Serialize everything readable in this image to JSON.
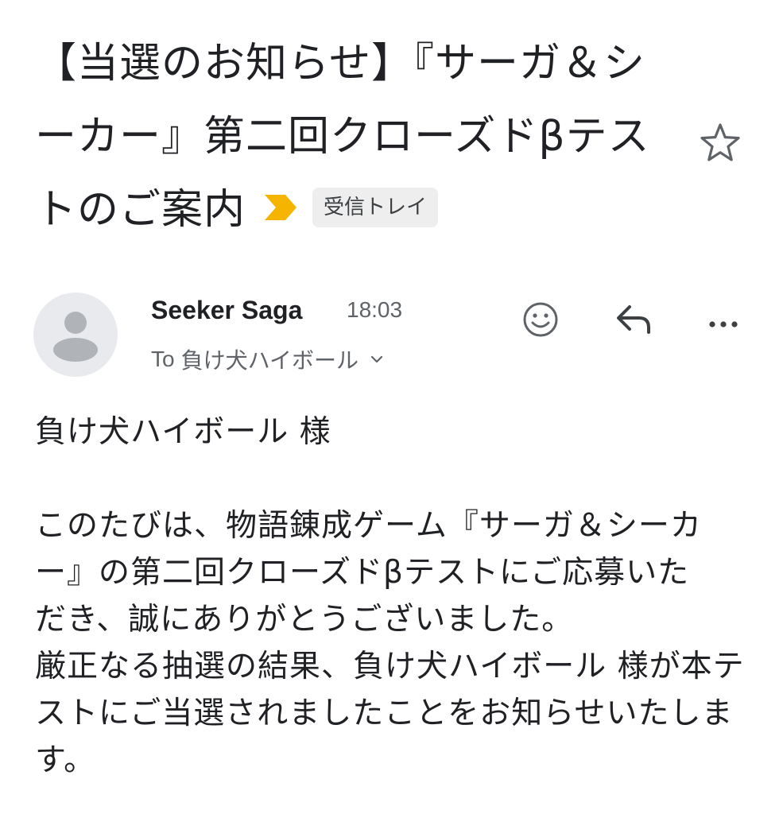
{
  "email": {
    "subject": "【当選のお知らせ】『サーガ＆シーカー』第二回クローズドβテストのご案内",
    "label": "受信トレイ",
    "importance_color": "#f4b400",
    "sender": {
      "name": "Seeker Saga",
      "time": "18:03",
      "to_label": "To",
      "recipient": "負け犬ハイボール"
    },
    "actions": {
      "emoji_icon": "smiley-icon",
      "reply_icon": "reply-icon",
      "more_icon": "more-icon"
    },
    "body": {
      "greeting": "負け犬ハイボール 様",
      "paragraph1": "このたびは、物語錬成ゲーム『サーガ＆シーカー』の第二回クローズドβテストにご応募いただき、誠にありがとうございました。",
      "paragraph2": "厳正なる抽選の結果、負け犬ハイボール 様が本テストにご当選されましたことをお知らせいたします。"
    }
  }
}
